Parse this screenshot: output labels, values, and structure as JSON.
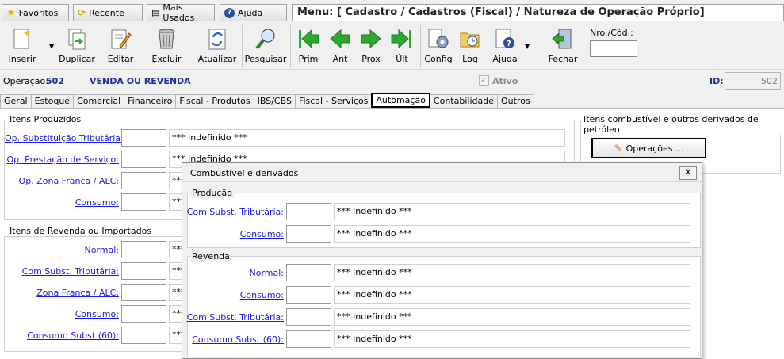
{
  "topbar": {
    "favoritos": "Favoritos",
    "recente": "Recente",
    "mais_usados": "Mais Usados",
    "ajuda": "Ajuda",
    "menu_title": "Menu: [ Cadastro / Cadastros (Fiscal) / Natureza de Operação Próprio]"
  },
  "toolbar": {
    "inserir": "Inserir",
    "duplicar": "Duplicar",
    "editar": "Editar",
    "excluir": "Excluir",
    "atualizar": "Atualizar",
    "pesquisar": "Pesquisar",
    "prim": "Prim",
    "ant": "Ant",
    "prox": "Próx",
    "ult": "Últ",
    "config": "Config",
    "log": "Log",
    "ajuda": "Ajuda",
    "fechar": "Fechar",
    "nro_label": "Nro./Cód.:",
    "nro_value": ""
  },
  "header": {
    "operacao_label": "Operação:",
    "operacao_num": "502",
    "operacao_name": "VENDA OU REVENDA",
    "ativo_label": "Ativo",
    "ativo_checked": true,
    "id_label": "ID:",
    "id_value": "502"
  },
  "tabs": [
    "Geral",
    "Estoque",
    "Comercial",
    "Financeiro",
    "Fiscal - Produtos",
    "IBS/CBS",
    "Fiscal - Serviços",
    "Automação",
    "Contabilidade",
    "Outros"
  ],
  "active_tab": "Automação",
  "produzidos": {
    "title": "Itens Produzidos",
    "rows": [
      {
        "label": "Op. Substituição Tributária:",
        "desc": "*** Indefinido ***"
      },
      {
        "label": "Op. Prestação de Serviço:",
        "desc": "*** Indefinido ***"
      },
      {
        "label": "Op. Zona Franca / ALC:",
        "desc": "***"
      },
      {
        "label": "Consumo:",
        "desc": "***"
      }
    ]
  },
  "revenda_main": {
    "title": "Itens de Revenda ou Importados",
    "rows": [
      {
        "label": "Normal:",
        "desc": "***"
      },
      {
        "label": "Com Subst. Tributária:",
        "desc": "***"
      },
      {
        "label": "Zona Franca / ALC:",
        "desc": "***"
      },
      {
        "label": "Consumo:",
        "desc": "***"
      },
      {
        "label": "Consumo Subst (60):",
        "desc": "***"
      }
    ]
  },
  "combustivel": {
    "title": "Itens combustível e outros derivados de petróleo",
    "button": "Operações ..."
  },
  "dialog": {
    "title": "Combustível e derivados",
    "close": "X",
    "producao": {
      "title": "Produção",
      "rows": [
        {
          "label": "Com Subst. Tributária:",
          "desc": "*** Indefinido ***"
        },
        {
          "label": "Consumo:",
          "desc": "*** Indefinido ***"
        }
      ]
    },
    "revenda": {
      "title": "Revenda",
      "rows": [
        {
          "label": "Normal:",
          "desc": "*** Indefinido ***"
        },
        {
          "label": "Consumo:",
          "desc": "*** Indefinido ***"
        },
        {
          "label": "Com Subst. Tributária:",
          "desc": "*** Indefinido ***"
        },
        {
          "label": "Consumo Subst (60):",
          "desc": "*** Indefinido ***"
        }
      ]
    }
  },
  "colors": {
    "header_blue": "#1f2f8f",
    "link_blue": "#1a1ae6",
    "arrow_green": "#2fa82f"
  }
}
